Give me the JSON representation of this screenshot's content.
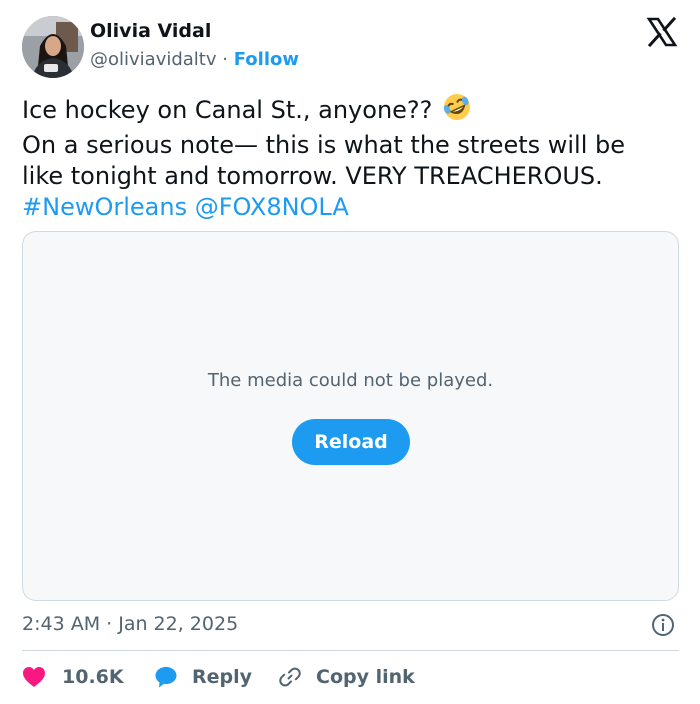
{
  "author": {
    "name": "Olivia Vidal",
    "handle": "@oliviavidaltv",
    "separator": "·",
    "follow_label": "Follow"
  },
  "tweet": {
    "line1": "Ice hockey on Canal St., anyone??",
    "line2": "On a serious note— this is what the streets will be",
    "line3": "like tonight and tomorrow. VERY TREACHEROUS.",
    "hashtag": "#NewOrleans",
    "mention": "@FOX8NOLA",
    "emoji": "rolling-on-floor-laughing-emoji"
  },
  "media": {
    "message": "The media could not be played.",
    "reload_label": "Reload"
  },
  "meta": {
    "timestamp": "2:43 AM · Jan 22, 2025"
  },
  "actions": {
    "like_count": "10.6K",
    "reply_label": "Reply",
    "copy_label": "Copy link"
  },
  "colors": {
    "accent": "#1d9bf0",
    "like": "#f91880",
    "text": "#0f1419",
    "muted": "#536471"
  }
}
